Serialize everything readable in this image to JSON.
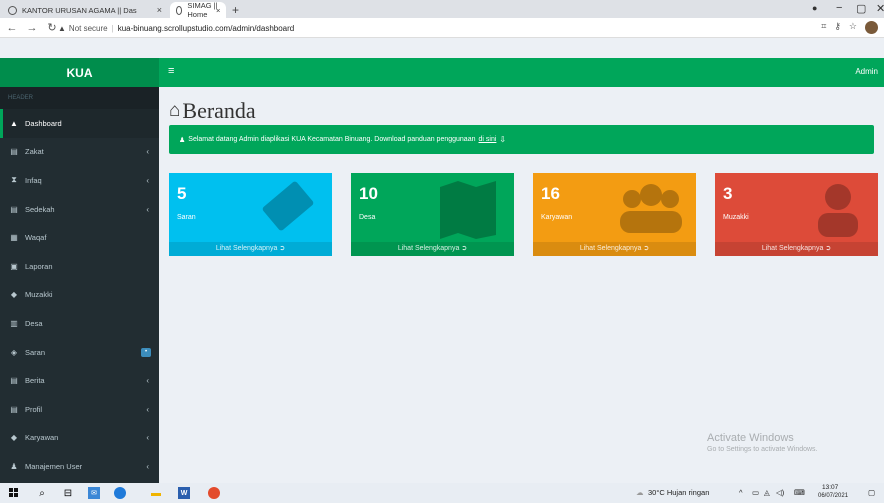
{
  "browser": {
    "tabs": [
      {
        "title": "KANTOR URUSAN AGAMA || Das",
        "close": "×"
      },
      {
        "title": "SIMAG || Home",
        "close": "×"
      }
    ],
    "new_tab": "+",
    "window_controls": {
      "minimize": "−",
      "maximize": "▢",
      "close": "✕"
    },
    "security_label": "Not secure",
    "url": "kua-binuang.scrollupstudio.com/admin/dashboard"
  },
  "header": {
    "brand": "KUA",
    "menu_icon": "≡",
    "user": "Admin"
  },
  "sidebar": {
    "heading": "HEADER",
    "items": [
      {
        "label": "Dashboard",
        "icon": "▲",
        "chevron": "",
        "active": true
      },
      {
        "label": "Zakat",
        "icon": "▤",
        "chevron": "‹"
      },
      {
        "label": "Infaq",
        "icon": "⧗",
        "chevron": "‹"
      },
      {
        "label": "Sedekah",
        "icon": "▤",
        "chevron": "‹"
      },
      {
        "label": "Waqaf",
        "icon": "▦",
        "chevron": ""
      },
      {
        "label": "Laporan",
        "icon": "▣",
        "chevron": ""
      },
      {
        "label": "Muzakki",
        "icon": "◆",
        "chevron": ""
      },
      {
        "label": "Desa",
        "icon": "▥",
        "chevron": ""
      },
      {
        "label": "Saran",
        "icon": "◈",
        "chevron": "",
        "badge": "•"
      },
      {
        "label": "Berita",
        "icon": "▤",
        "chevron": "‹"
      },
      {
        "label": "Profil",
        "icon": "▤",
        "chevron": "‹"
      },
      {
        "label": "Karyawan",
        "icon": "◆",
        "chevron": "‹"
      },
      {
        "label": "Manajemen User",
        "icon": "♟",
        "chevron": "‹"
      }
    ]
  },
  "main": {
    "title": "Beranda",
    "home_icon": "⌂",
    "alert_text": "Selamat datang Admin diaplikasi KUA Kecamatan Binuang. Download panduan penggunaan",
    "alert_link": "di sini",
    "boxes": [
      {
        "number": "5",
        "label": "Saran",
        "footer": "Lihat Selengkapnya ➲",
        "color": "#00c0ef"
      },
      {
        "number": "10",
        "label": "Desa",
        "footer": "Lihat Selengkapnya ➲",
        "color": "#00a65a"
      },
      {
        "number": "16",
        "label": "Karyawan",
        "footer": "Lihat Selengkapnya ➲",
        "color": "#f39c12"
      },
      {
        "number": "3",
        "label": "Muzakki",
        "footer": "Lihat Selengkapnya ➲",
        "color": "#dd4b39"
      }
    ],
    "watermark_title": "Activate Windows",
    "watermark_sub": "Go to Settings to activate Windows."
  },
  "taskbar": {
    "weather": "30°C  Hujan ringan",
    "time": "13:07",
    "date": "06/07/2021"
  }
}
